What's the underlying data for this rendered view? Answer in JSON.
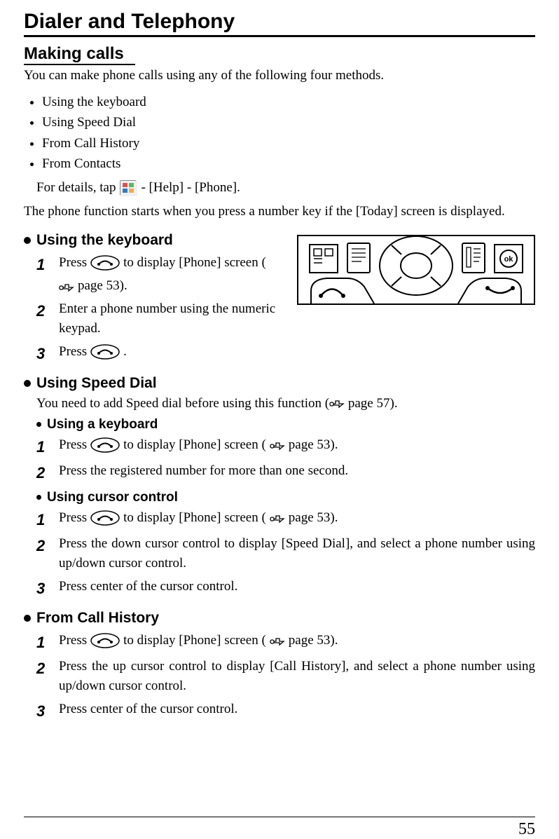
{
  "chapterTitle": "Dialer and Telephony",
  "sectionTitle": "Making calls",
  "intro": "You can make phone calls using any of the following four methods.",
  "methods": [
    "Using the keyboard",
    "Using Speed Dial",
    "From Call History",
    "From Contacts"
  ],
  "details": {
    "prefix": "For details, tap",
    "suffix": " - [Help] - [Phone]."
  },
  "phoneFunc": "The phone function starts when you press a number key if the [Today] screen is displayed.",
  "usingKeyboard": {
    "title": "Using the keyboard",
    "step1a": "Press",
    "step1b": "to display [Phone] screen (",
    "step1c": " page 53).",
    "step2": "Enter a phone number using the numeric keypad.",
    "step3a": "Press",
    "step3b": "."
  },
  "usingSpeedDial": {
    "title": "Using Speed Dial",
    "note_a": "You need to add Speed dial before using this function (",
    "note_b": " page 57).",
    "kb": {
      "title": "Using a keyboard",
      "step1a": "Press",
      "step1b": "to display [Phone] screen (",
      "step1c": " page 53).",
      "step2": "Press the registered number for more than one second."
    },
    "cc": {
      "title": "Using cursor control",
      "step1a": "Press",
      "step1b": "to display [Phone] screen (",
      "step1c": " page 53).",
      "step2": "Press the down cursor control to display [Speed Dial], and select a phone number using up/down cursor control.",
      "step3": "Press center of the cursor control."
    }
  },
  "fromCallHistory": {
    "title": "From Call History",
    "step1a": "Press",
    "step1b": "to display [Phone] screen (",
    "step1c": " page 53).",
    "step2": "Press the up cursor control to display [Call History], and select a phone number using up/down cursor control.",
    "step3": "Press center of the cursor control."
  },
  "pageNumber": "55"
}
